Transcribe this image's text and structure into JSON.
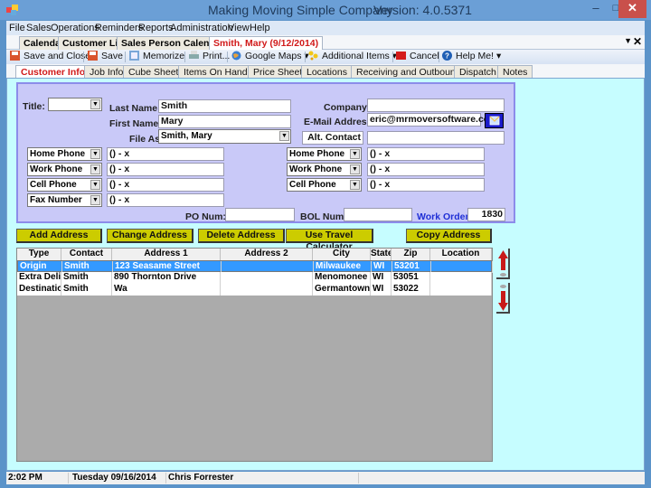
{
  "window": {
    "title": "Making Moving Simple Company",
    "version": "Version: 4.0.5371",
    "controls": {
      "minimize": "–",
      "maximize": "□",
      "close": "✕"
    }
  },
  "menu": [
    "File",
    "Sales",
    "Operations",
    "Reminders",
    "Reports",
    "Administration",
    "View",
    "Help"
  ],
  "doc_tabs": [
    {
      "label": "Calendar",
      "active": false
    },
    {
      "label": "Customer List",
      "active": false
    },
    {
      "label": "Sales Person Calendar",
      "active": false
    },
    {
      "label": "Smith, Mary  (9/12/2014)",
      "active": true
    }
  ],
  "toolbar": {
    "save_close": "Save and Close",
    "save": "Save",
    "memorize": "Memorize",
    "print": "Print...",
    "google_maps": "Google Maps",
    "additional_items": "Additional Items",
    "cancel": "Cancel",
    "help": "Help Me!",
    "dropdown_arrow": "▾"
  },
  "page_tabs": [
    {
      "label": "Customer Info",
      "active": true
    },
    {
      "label": "Job Info"
    },
    {
      "label": "Cube Sheet"
    },
    {
      "label": "Items On Hand"
    },
    {
      "label": "Price Sheet"
    },
    {
      "label": "Locations"
    },
    {
      "label": "Receiving and Outbound"
    },
    {
      "label": "Dispatch"
    },
    {
      "label": "Notes"
    }
  ],
  "form": {
    "title_label": "Title:",
    "title_value": "",
    "last_name_label": "Last Name:",
    "last_name": "Smith",
    "first_name_label": "First Name:",
    "first_name": "Mary",
    "file_as_label": "File As:",
    "file_as": "Smith, Mary",
    "company_label": "Company:",
    "company": "",
    "email_label": "E-Mail Address:",
    "email": "eric@mrmoversoftware.com",
    "alt_contact_label": "Alt. Contact",
    "alt_contact": "",
    "phones_left": [
      {
        "type": "Home Phone",
        "value": "() - x"
      },
      {
        "type": "Work Phone",
        "value": "() - x"
      },
      {
        "type": "Cell Phone",
        "value": "() - x"
      },
      {
        "type": "Fax Number",
        "value": "() - x"
      }
    ],
    "phones_right": [
      {
        "type": "Home Phone",
        "value": "() - x"
      },
      {
        "type": "Work Phone",
        "value": "() - x"
      },
      {
        "type": "Cell Phone",
        "value": "() - x"
      }
    ],
    "po_label": "PO Num:",
    "po_value": "",
    "bol_label": "BOL Num:",
    "bol_value": "",
    "work_order_label": "Work Order:",
    "work_order": "1830"
  },
  "buttons": {
    "add_address": "Add Address",
    "change_address": "Change Address",
    "delete_address": "Delete Address",
    "travel_calc": "Use Travel Calculator",
    "copy_address": "Copy Address"
  },
  "grid": {
    "columns": [
      "Type",
      "Contact",
      "Address 1",
      "Address 2",
      "City",
      "State",
      "Zip",
      "Location"
    ],
    "rows": [
      {
        "type": "Origin",
        "contact": "Smith",
        "address1": "123 Seasame Street",
        "address2": "",
        "city": "Milwaukee",
        "state": "WI",
        "zip": "53201",
        "location": "",
        "selected": true
      },
      {
        "type": "Extra Delivery",
        "contact": "Smith",
        "address1": "890 Thornton Drive",
        "address2": "",
        "city": "Menomonee Falls",
        "state": "WI",
        "zip": "53051",
        "location": ""
      },
      {
        "type": "Destination",
        "contact": "Smith",
        "address1": "Wa",
        "address2": "",
        "city": "Germantown",
        "state": "WI",
        "zip": "53022",
        "location": ""
      }
    ]
  },
  "status": {
    "time": "2:02 PM",
    "date": "Tuesday 09/16/2014",
    "user": "Chris Forrester"
  },
  "colors": {
    "content_bg": "#c6fdff",
    "form_bg": "#c9c9f8",
    "button_bg": "#cccc00",
    "selected_row": "#3399ff",
    "active_tab_text": "#d11a1a",
    "work_order_label": "#1f2fd6"
  }
}
